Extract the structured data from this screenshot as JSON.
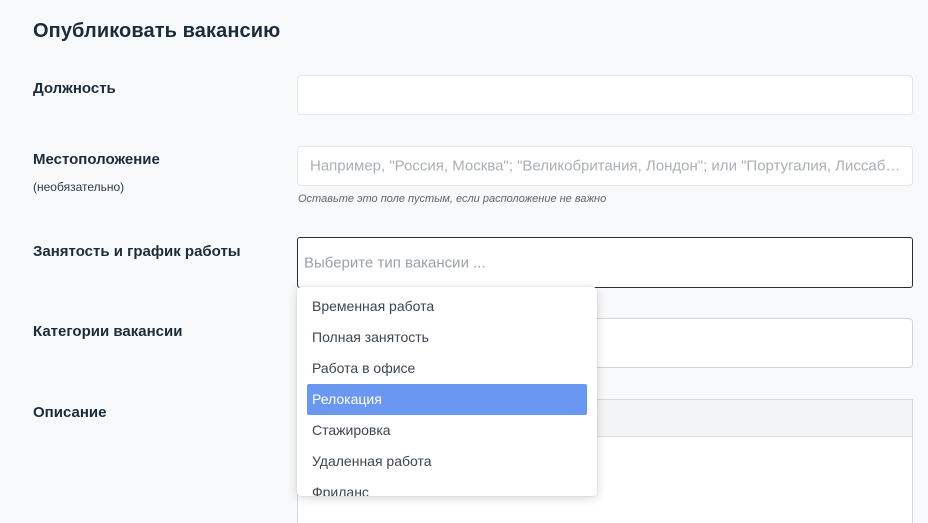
{
  "page": {
    "title": "Опубликовать вакансию"
  },
  "form": {
    "position": {
      "label": "Должность",
      "value": ""
    },
    "location": {
      "label": "Местоположение",
      "sublabel": "(необязательно)",
      "placeholder": "Например, \"Россия, Москва\"; \"Великобритания, Лондон\"; или \"Португалия, Лиссабон\"",
      "hint": "Оставьте это поле пустым, если расположение не важно"
    },
    "employment": {
      "label": "Занятость и график работы",
      "placeholder": "Выберите тип вакансии ..."
    },
    "categories": {
      "label": "Категории вакансии"
    },
    "description": {
      "label": "Описание"
    }
  },
  "dropdown": {
    "options": [
      "Временная работа",
      "Полная занятость",
      "Работа в офисе",
      "Релокация",
      "Стажировка",
      "Удаленная работа",
      "Фриланс"
    ],
    "highlighted": "Релокация"
  },
  "colors": {
    "highlight": "#6a98f0",
    "text_dark": "#1c2b3a",
    "background": "#f8f9fa"
  }
}
